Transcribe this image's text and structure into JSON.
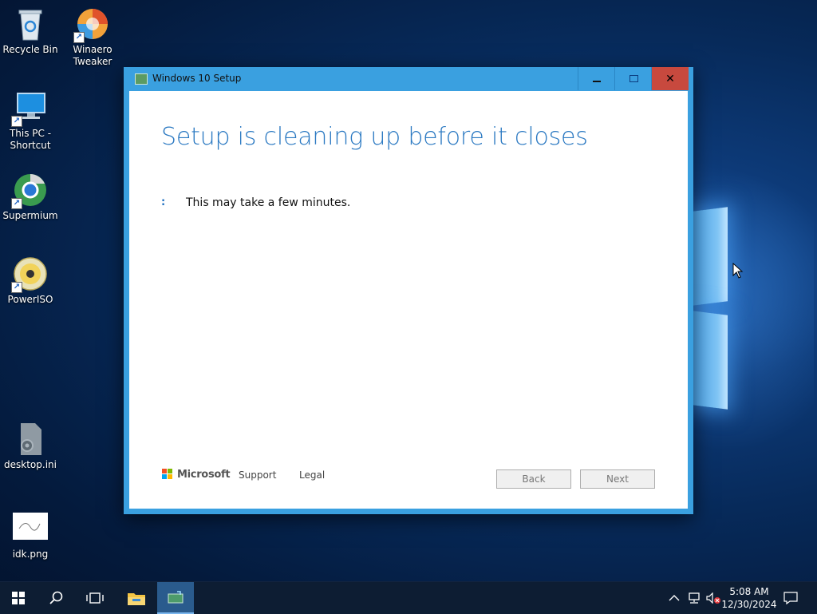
{
  "desktop": {
    "icons": [
      {
        "label": "Recycle Bin",
        "icon": "recycle-bin-icon",
        "shortcut": false
      },
      {
        "label": "Winaero Tweaker",
        "icon": "winaero-tweaker-icon",
        "shortcut": true
      },
      {
        "label": "This PC - Shortcut",
        "icon": "this-pc-icon",
        "shortcut": true
      },
      {
        "label": "Supermium",
        "icon": "supermium-icon",
        "shortcut": true
      },
      {
        "label": "PowerISO",
        "icon": "poweriso-icon",
        "shortcut": true
      },
      {
        "label": "desktop.ini",
        "icon": "settings-file-icon",
        "shortcut": false
      },
      {
        "label": "idk.png",
        "icon": "image-file-icon",
        "shortcut": false
      }
    ]
  },
  "window": {
    "title": "Windows 10 Setup",
    "heading": "Setup is cleaning up before it closes",
    "spinner": ":",
    "message": "This may take a few minutes.",
    "footer": {
      "brand": "Microsoft",
      "support_label": "Support",
      "legal_label": "Legal",
      "back_label": "Back",
      "next_label": "Next"
    },
    "colors": {
      "accent": "#2b79c2",
      "frame": "#3aa0e0",
      "close": "#c8493e"
    }
  },
  "taskbar": {
    "time": "5:08 AM",
    "date": "12/30/2024",
    "icons": [
      "start-icon",
      "search-icon",
      "task-view-icon",
      "file-explorer-icon",
      "windows-setup-icon"
    ],
    "tray_icons": [
      "chevron-up-icon",
      "network-icon",
      "volume-muted-icon",
      "notification-icon"
    ]
  }
}
